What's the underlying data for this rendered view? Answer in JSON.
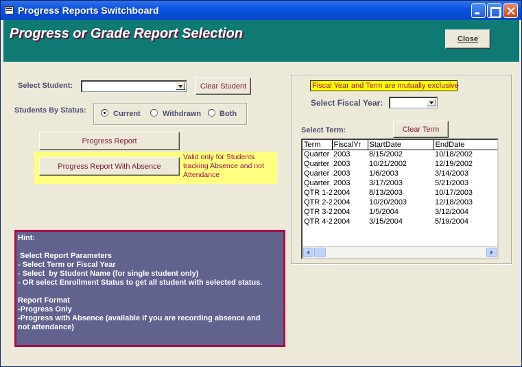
{
  "window": {
    "title": "Progress Reports Switchboard"
  },
  "header": {
    "title": "Progress or Grade Report Selection",
    "close_label": "Close"
  },
  "student": {
    "label": "Select Student:",
    "value": "",
    "clear_label": "Clear Student"
  },
  "status": {
    "label": "Students By Status:",
    "options": [
      "Current",
      "Withdrawn",
      "Both"
    ],
    "selected": "Current"
  },
  "reports": {
    "progress_label": "Progress Report",
    "absence_label": "Progress Report With Absence",
    "absence_note": "Valid only for Students tracking Absence and not Attendance"
  },
  "hint": {
    "lines": [
      "Hint:",
      "",
      " Select Report Parameters",
      "- Select Term or Fiscal Year",
      "- Select  by Student Name (for single student only)",
      "- OR select Enrollment Status to get all student with selected status.",
      "",
      "Report Format",
      "-Progress Only",
      "-Progress with Absence (available if you are recording absence and",
      "not attendance)"
    ]
  },
  "fiscal": {
    "exclusive_note": "Fiscal Year and Term are mutually exclusive",
    "label": "Select Fiscal Year:",
    "value": ""
  },
  "term": {
    "label": "Select Term:",
    "clear_label": "Clear Term",
    "columns": [
      "Term",
      "FiscalYr",
      "StartDate",
      "EndDate"
    ],
    "rows": [
      [
        "Quarter",
        "2003",
        "8/15/2002",
        "10/18/2002"
      ],
      [
        "Quarter",
        "2003",
        "10/21/2002",
        "12/19/2002"
      ],
      [
        "Quarter",
        "2003",
        "1/6/2003",
        "3/14/2003"
      ],
      [
        "Quarter",
        "2003",
        "3/17/2003",
        "5/21/2003"
      ],
      [
        "QTR 1-2",
        "2004",
        "8/13/2003",
        "10/17/2003"
      ],
      [
        "QTR 2-2",
        "2004",
        "10/20/2003",
        "12/18/2003"
      ],
      [
        "QTR 3-2",
        "2004",
        "1/5/2004",
        "3/12/2004"
      ],
      [
        "QTR 4-2",
        "2004",
        "3/15/2004",
        "5/19/2004"
      ]
    ]
  },
  "colors": {
    "header_bg": "#0e7a73",
    "hint_bg": "#61628d",
    "hint_border": "#a4104a",
    "note_yellow": "#ffff80",
    "accent_text": "#7a1535"
  }
}
